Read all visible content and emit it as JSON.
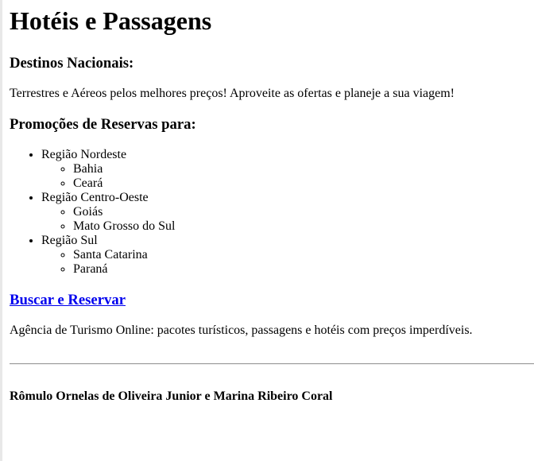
{
  "header": {
    "title": "Hotéis e Passagens"
  },
  "national": {
    "heading": "Destinos Nacionais:",
    "description": "Terrestres e Aéreos pelos melhores preços! Aproveite as ofertas e planeje a sua viagem!"
  },
  "promotions": {
    "heading": "Promoções de Reservas para:",
    "regions": [
      {
        "name": "Região Nordeste",
        "states": [
          "Bahia",
          "Ceará"
        ]
      },
      {
        "name": "Região Centro-Oeste",
        "states": [
          "Goiás",
          "Mato Grosso do Sul"
        ]
      },
      {
        "name": "Região Sul",
        "states": [
          "Santa Catarina",
          "Paraná"
        ]
      }
    ]
  },
  "cta": {
    "label": "Buscar e Reservar"
  },
  "about": {
    "text": "Agência de Turismo Online: pacotes turísticos, passagens e hotéis com preços imperdíveis."
  },
  "footer": {
    "authors": "Rômulo Ornelas de Oliveira Junior e Marina Ribeiro Coral"
  }
}
